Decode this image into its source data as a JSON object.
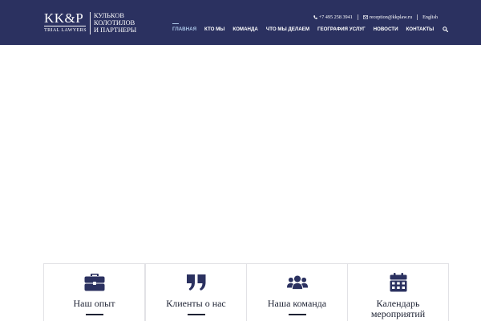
{
  "logo": {
    "mark": "KK&P",
    "subtitle": "TRIAL LAWYERS",
    "name_lines": [
      "КУЛЬКОВ",
      "КОЛОТИЛОВ",
      "И ПАРТНЕРЫ"
    ]
  },
  "topbar": {
    "phone": "+7 495 258 3941",
    "email": "reception@kkplaw.ru",
    "language": "English"
  },
  "nav": {
    "items": [
      {
        "label": "ГЛАВНАЯ",
        "active": true
      },
      {
        "label": "КТО МЫ"
      },
      {
        "label": "КОМАНДА"
      },
      {
        "label": "ЧТО МЫ ДЕЛАЕМ"
      },
      {
        "label": "ГЕОГРАФИЯ УСЛУГ"
      },
      {
        "label": "НОВОСТИ"
      },
      {
        "label": "КОНТАКТЫ"
      }
    ]
  },
  "cards": [
    {
      "label": "Наш опыт",
      "icon": "briefcase-icon"
    },
    {
      "label": "Клиенты о нас",
      "icon": "quote-icon"
    },
    {
      "label": "Наша команда",
      "icon": "users-icon"
    },
    {
      "label_lines": [
        "Календарь",
        "мероприятий"
      ],
      "icon": "calendar-icon"
    }
  ],
  "colors": {
    "header_bg": "#2b3160",
    "nav_active": "#a9c4e6",
    "icon": "#2b3160",
    "text_dark": "#1d2233"
  }
}
